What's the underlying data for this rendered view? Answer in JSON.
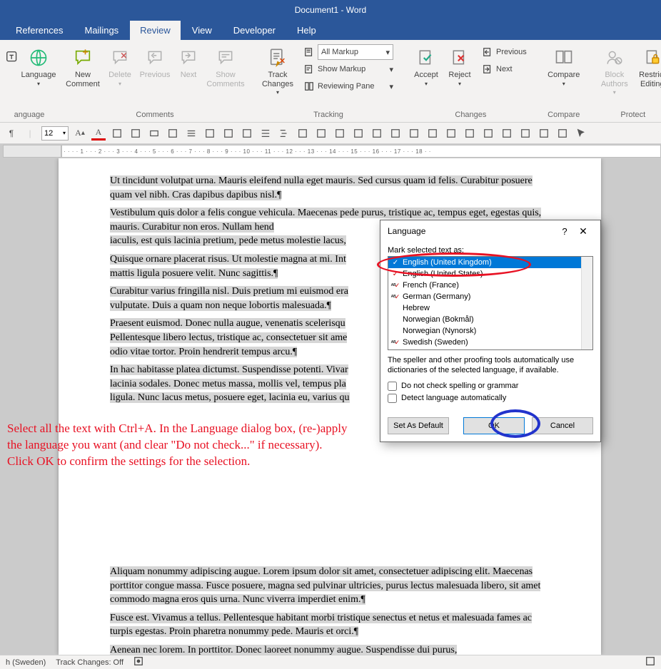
{
  "title": "Document1 - Word",
  "tabs": {
    "references": "References",
    "mailings": "Mailings",
    "review": "Review",
    "view": "View",
    "developer": "Developer",
    "help": "Help"
  },
  "ribbon": {
    "language_group_btn": "Language",
    "language_group_label": "anguage",
    "new_comment": "New\nComment",
    "delete": "Delete",
    "previous_c": "Previous",
    "next_c": "Next",
    "show_comments": "Show\nComments",
    "comments_label": "Comments",
    "track_changes": "Track\nChanges",
    "display_combo": "All Markup",
    "show_markup": "Show Markup",
    "reviewing_pane": "Reviewing Pane",
    "tracking_label": "Tracking",
    "accept": "Accept",
    "reject": "Reject",
    "previous_ch": "Previous",
    "next_ch": "Next",
    "changes_label": "Changes",
    "compare": "Compare",
    "compare_label": "Compare",
    "block_authors": "Block\nAuthors",
    "restrict_editing": "Restrict\nEditing",
    "protect_label": "Protect"
  },
  "qat": {
    "fontsize": "12"
  },
  "ruler_text": "· · · · 1 · · · 2 · · · 3 · · · 4 · · · 5 · · · 6 · · · 7 · · · 8 · · · 9 · · · 10 · · · 11 · · · 12 · · · 13 · · · 14 · · · 15 · · · 16 · · · 17 · · · 18 · ·",
  "doc": {
    "p1": "Ut tincidunt volutpat urna. Mauris eleifend nulla eget mauris. Sed cursus quam id felis. Curabitur posuere quam vel nibh. Cras dapibus dapibus nisl.¶",
    "p2": "Vestibulum quis dolor a felis congue vehicula. Maecenas pede purus, tristique ac, tempus eget, egestas quis, mauris. Curabitur non eros. Nullam hend",
    "p2b": "iaculis, est quis lacinia pretium, pede metus molestie lacus,",
    "p3": "Quisque ornare placerat risus. Ut molestie magna at mi. Int",
    "p3b": "mattis ligula posuere velit. Nunc sagittis.¶",
    "p4": "Curabitur varius fringilla nisl. Duis pretium mi euismod era",
    "p4b": "vulputate. Duis a quam non neque lobortis malesuada.¶",
    "p5": "Praesent euismod. Donec nulla augue, venenatis scelerisqu",
    "p5b": "Pellentesque libero lectus, tristique ac, consectetuer sit ame",
    "p5c": "odio vitae tortor. Proin hendrerit tempus arcu.¶",
    "p6": "In hac habitasse platea dictumst. Suspendisse potenti. Vivar",
    "p6b": "lacinia sodales. Donec metus massa, mollis vel, tempus pla",
    "p6c": "ligula. Nunc lacus metus, posuere eget, lacinia eu, varius qu",
    "p7": "Aliquam nonummy adipiscing augue. Lorem ipsum dolor sit amet, consectetuer adipiscing elit. Maecenas porttitor congue massa. Fusce posuere, magna sed pulvinar ultricies, purus lectus malesuada libero, sit amet commodo magna eros quis urna. Nunc viverra imperdiet enim.¶",
    "p8": "Fusce est. Vivamus a tellus. Pellentesque habitant morbi tristique senectus et netus et malesuada fames ac turpis egestas. Proin pharetra nonummy pede. Mauris et orci.¶",
    "p9": "Aenean nec lorem. In porttitor. Donec laoreet nonummy augue. Suspendisse dui purus,"
  },
  "dialog": {
    "title": "Language",
    "mark_label": "Mark selected text as:",
    "items": [
      "English (United Kingdom)",
      "English (United States)",
      "French (France)",
      "German (Germany)",
      "Hebrew",
      "Norwegian (Bokmål)",
      "Norwegian (Nynorsk)",
      "Swedish (Sweden)"
    ],
    "note": "The speller and other proofing tools automatically use dictionaries of the selected language, if available.",
    "cb1": "Do not check spelling or grammar",
    "cb2": "Detect language automatically",
    "set_default": "Set As Default",
    "ok": "OK",
    "cancel": "Cancel"
  },
  "annotation": "Select all the text with Ctrl+A. In the Language dialog box, (re-)apply the language you want (and clear \"Do not check...\" if necessary). Click OK to confirm the settings for the selection.",
  "statusbar": {
    "lang": "h (Sweden)",
    "track": "Track Changes: Off"
  }
}
